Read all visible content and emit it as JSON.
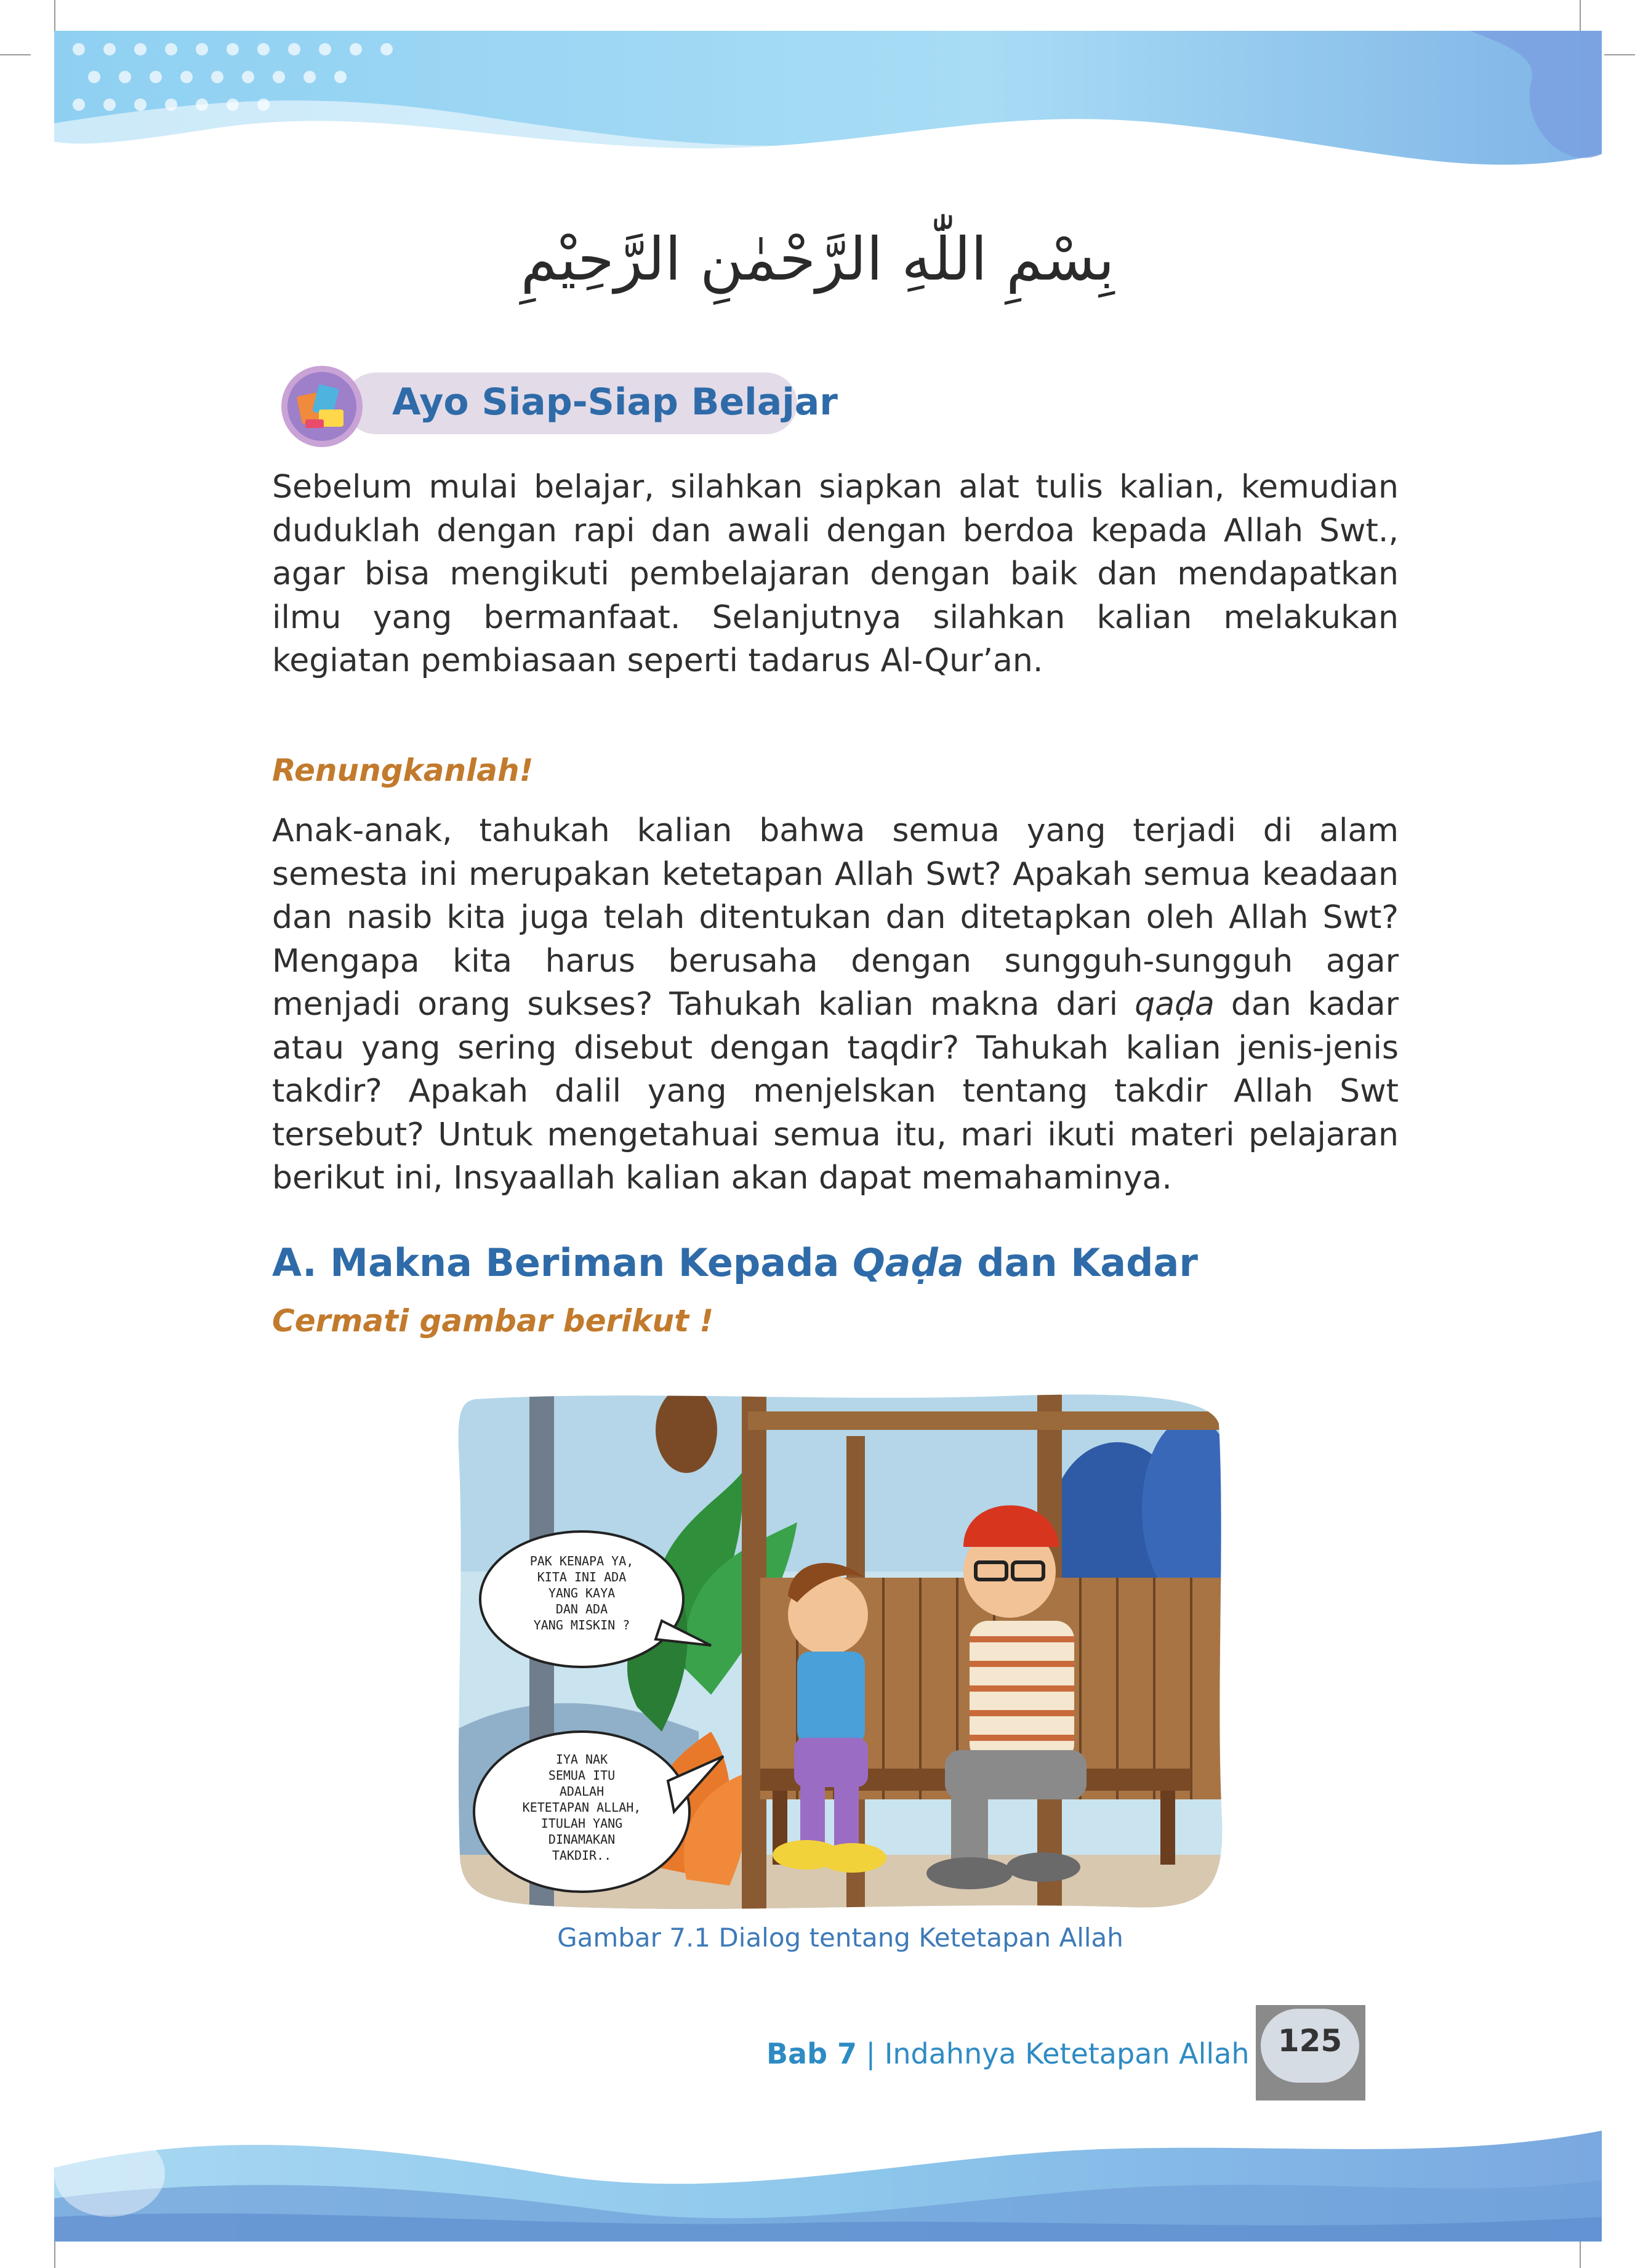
{
  "basmala": "بِسْمِ اللّٰهِ الرَّحْمٰنِ الرَّحِيْمِ",
  "section_box": {
    "title": "Ayo Siap-Siap Belajar",
    "icon": "books-icon"
  },
  "intro_paragraph": "Sebelum mulai belajar, silahkan siapkan alat tulis kalian, kemudian duduklah dengan rapi dan awali dengan berdoa kepada Allah Swt., agar bisa mengikuti pembelajaran dengan baik dan mendapatkan ilmu yang bermanfaat. Selanjutnya silahkan kalian melakukan kegiatan pembiasaan seperti tadarus Al-Qur’an.",
  "reflect": {
    "heading": "Renungkanlah!",
    "text_1": "Anak-anak, tahukah kalian bahwa semua yang terjadi di alam semesta ini merupakan ketetapan Allah Swt? Apakah semua keadaan dan nasib kita juga telah ditentukan dan ditetapkan oleh Allah Swt? Mengapa kita harus berusaha dengan sungguh-sungguh agar menjadi orang sukses? Tahukah kalian makna dari ",
    "italic_word": "qaḍa",
    "text_2": " dan kadar atau yang sering disebut dengan taqdir? Tahukah kalian jenis-jenis takdir? Apakah dalil yang menjelskan tentang takdir Allah Swt tersebut? Untuk mengetahuai semua itu, mari ikuti materi pelajaran berikut ini, Insyaallah kalian akan dapat memahaminya."
  },
  "section_a": {
    "prefix": "A.  Makna Beriman Kepada ",
    "italic": "Qaḍa",
    "suffix": " dan Kadar",
    "subheading": "Cermati gambar berikut !"
  },
  "comic": {
    "bubble_1": [
      "PAK KENAPA YA,",
      "KITA INI ADA",
      "YANG KAYA",
      "DAN ADA",
      "YANG MISKIN ?"
    ],
    "bubble_2": [
      "IYA NAK",
      "SEMUA ITU",
      "ADALAH",
      "KETETAPAN ALLAH,",
      "ITULAH YANG",
      "DINAMAKAN",
      "TAKDIR.."
    ]
  },
  "figure_caption": "Gambar 7.1  Dialog tentang Ketetapan Allah",
  "footer": {
    "chapter_label": "Bab 7",
    "separator": " | ",
    "chapter_title": "Indahnya Ketetapan Allah",
    "page_number": "125"
  },
  "colors": {
    "heading_blue": "#2e6ba8",
    "accent_orange": "#c27a2c",
    "pill_bg": "#e3dbe8",
    "banner_blue": "#8cc8ec"
  }
}
